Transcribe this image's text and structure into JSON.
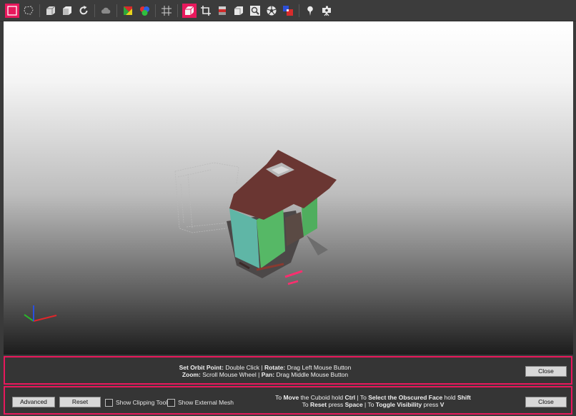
{
  "toolbar": {
    "tools": [
      {
        "name": "select-rectangle-icon",
        "active": true
      },
      {
        "name": "select-lasso-icon",
        "active": false
      },
      {
        "name": "cuboid-icon",
        "active": false
      },
      {
        "name": "cuboid-face-icon",
        "active": false
      },
      {
        "name": "rotate-icon",
        "active": false
      },
      {
        "name": "point-cloud-icon",
        "active": false
      },
      {
        "name": "color-by-normal-icon",
        "active": false
      },
      {
        "name": "color-by-rgb-icon",
        "active": false
      },
      {
        "name": "grid-icon",
        "active": false
      },
      {
        "name": "cuboid-select-icon",
        "active": true
      },
      {
        "name": "crop-icon",
        "active": false
      },
      {
        "name": "slice-layers-icon",
        "active": false
      },
      {
        "name": "box-view-icon",
        "active": false
      },
      {
        "name": "zoom-fit-icon",
        "active": false
      },
      {
        "name": "aperture-icon",
        "active": false
      },
      {
        "name": "classify-icon",
        "active": false
      },
      {
        "name": "pin-icon",
        "active": false
      },
      {
        "name": "camera-icon",
        "active": false
      }
    ]
  },
  "viewport": {
    "axis_colors": {
      "x": "#e0262a",
      "y": "#2bb32b",
      "z": "#2a4fe0"
    }
  },
  "navigation_hint": {
    "line1": [
      {
        "t": "Set Orbit Point:",
        "b": true
      },
      {
        "t": " Double Click | ",
        "b": false
      },
      {
        "t": "Rotate:",
        "b": true
      },
      {
        "t": " Drag Left Mouse Button",
        "b": false
      }
    ],
    "line2": [
      {
        "t": "Zoom:",
        "b": true
      },
      {
        "t": " Scroll Mouse Wheel | ",
        "b": false
      },
      {
        "t": "Pan:",
        "b": true
      },
      {
        "t": " Drag Middle Mouse Button",
        "b": false
      }
    ],
    "close_label": "Close"
  },
  "cuboid_panel": {
    "advanced_label": "Advanced",
    "reset_label": "Reset",
    "show_clipping_tool_label": "Show Clipping Tool",
    "show_external_mesh_label": "Show External Mesh",
    "line1": [
      {
        "t": "To ",
        "b": false
      },
      {
        "t": "Move",
        "b": true
      },
      {
        "t": " the Cuboid hold ",
        "b": false
      },
      {
        "t": "Ctrl",
        "b": true
      },
      {
        "t": " | To ",
        "b": false
      },
      {
        "t": "Select the Obscured Face",
        "b": true
      },
      {
        "t": " hold ",
        "b": false
      },
      {
        "t": "Shift",
        "b": true
      }
    ],
    "line2": [
      {
        "t": "To ",
        "b": false
      },
      {
        "t": "Reset",
        "b": true
      },
      {
        "t": " press ",
        "b": false
      },
      {
        "t": "Space",
        "b": true
      },
      {
        "t": " | To ",
        "b": false
      },
      {
        "t": "Toggle Visibility",
        "b": true
      },
      {
        "t": " press ",
        "b": false
      },
      {
        "t": "V",
        "b": true
      }
    ],
    "close_label": "Close"
  },
  "colors": {
    "accent": "#e8185c"
  }
}
